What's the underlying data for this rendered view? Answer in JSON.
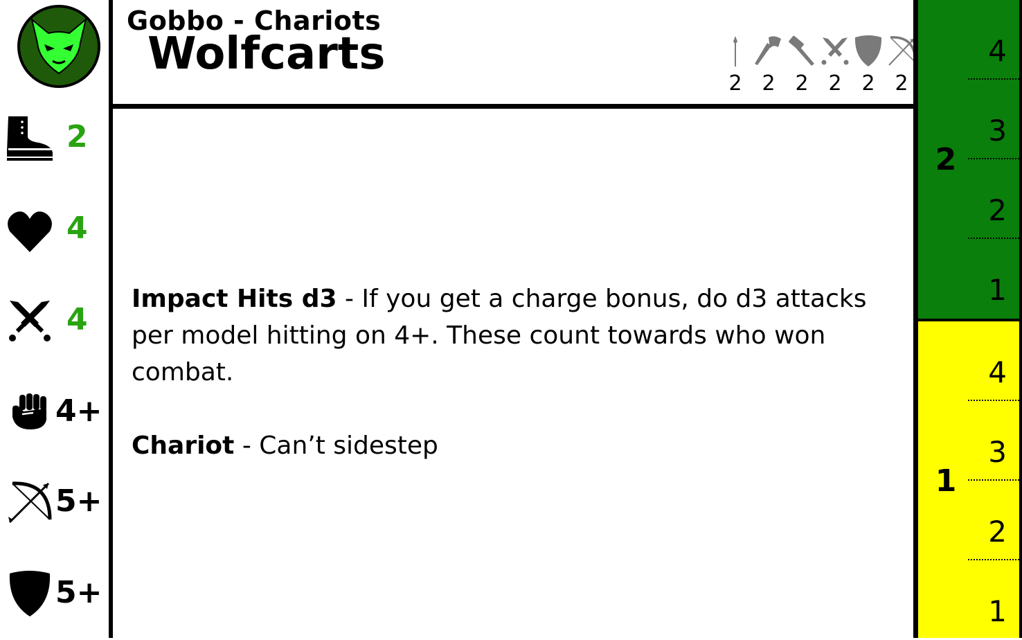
{
  "card": {
    "faction": "Gobbo - Chariots",
    "unit_name": "Wolfcarts"
  },
  "stats": [
    {
      "icon": "boot-icon",
      "value": "2",
      "color": "#2aa312"
    },
    {
      "icon": "heart-icon",
      "value": "4",
      "color": "#2aa312"
    },
    {
      "icon": "crossed-swords-icon",
      "value": "4",
      "color": "#2aa312"
    },
    {
      "icon": "fist-icon",
      "value": "4+",
      "color": "#000000"
    },
    {
      "icon": "bow-icon",
      "value": "5+",
      "color": "#000000"
    },
    {
      "icon": "shield-icon",
      "value": "5+",
      "color": "#000000"
    }
  ],
  "weapons": [
    {
      "icon": "spear-icon",
      "value": "2"
    },
    {
      "icon": "axe-icon",
      "value": "2"
    },
    {
      "icon": "hammer-icon",
      "value": "2"
    },
    {
      "icon": "crossed-swords-icon",
      "value": "2"
    },
    {
      "icon": "shield-icon",
      "value": "2"
    },
    {
      "icon": "bow-icon",
      "value": "2"
    }
  ],
  "rules": [
    {
      "name": "Impact Hits d3",
      "text": " - If you get a charge bonus, do d3 attacks per model hitting on 4+. These count towards who won combat."
    },
    {
      "name": "Chariot",
      "text": " - Can’t sidestep"
    }
  ],
  "tracker": {
    "colors": {
      "upper": "#0b7f0b",
      "lower": "#ffff00"
    },
    "upper_label": "2",
    "upper_values": [
      "4",
      "3",
      "2",
      "1"
    ],
    "lower_label": "1",
    "lower_values": [
      "4",
      "3",
      "2",
      "1"
    ]
  },
  "emblem": {
    "icon": "goblin-face-icon",
    "bg": "#1f5a0a",
    "face": "#33ff33"
  }
}
